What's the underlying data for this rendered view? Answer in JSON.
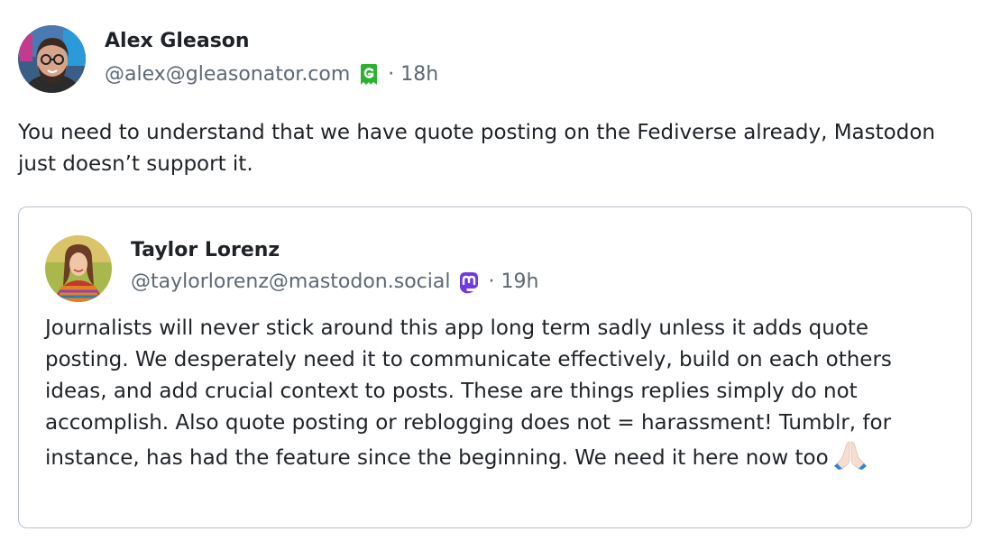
{
  "post": {
    "author": {
      "display_name": "Alex Gleason",
      "handle": "@alex@gleasonator.com",
      "server_icon": "gleasonator-icon",
      "server_icon_color": "#2bb32f",
      "separator": "·",
      "time": "18h"
    },
    "text": "You need to understand that we have quote posting on the Fediverse already, Mastodon just doesn’t support it."
  },
  "quote": {
    "author": {
      "display_name": "Taylor Lorenz",
      "handle": "@taylorlorenz@mastodon.social",
      "server_icon": "mastodon-icon",
      "server_icon_color": "#6f3ae0",
      "separator": "·",
      "time": "19h"
    },
    "text": "Journalists will never stick around this app long term sadly unless it adds quote posting. We desperately need it to communicate effectively, build on each others ideas, and add crucial context to posts. These are things replies simply do not accomplish. Also quote posting or reblogging does not = harassment! Tumblr, for instance, has had the feature since the beginning. We need it here now too",
    "emoji": "folded-hands-emoji"
  },
  "colors": {
    "text": "#1f2328",
    "muted": "#5b6876",
    "border": "#b9c2cb"
  }
}
